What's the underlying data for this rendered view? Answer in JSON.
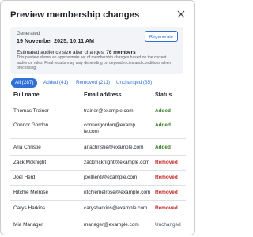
{
  "dialog": {
    "title": "Preview membership changes"
  },
  "summary": {
    "generated_label": "Generated",
    "generated_date": "19 November 2025, 10:11 AM",
    "regenerate_label": "Regenerate",
    "estimate_prefix": "Estimated audience size after changes:",
    "estimate_value": "76 members",
    "note": "This preview shows an approximate set of membership changes based on the current audience rules. Final results may vary depending on dependencies and conditions when processing."
  },
  "tabs": [
    {
      "label": "All (287)",
      "active": true
    },
    {
      "label": "Added (41)",
      "active": false
    },
    {
      "label": "Removed (211)",
      "active": false
    },
    {
      "label": "Unchanged (35)",
      "active": false
    }
  ],
  "table": {
    "columns": [
      "Full name",
      "Email address",
      "Status"
    ],
    "rows": [
      {
        "name": "Thomas Trainer",
        "email": "trainer@example.com",
        "status": "Added"
      },
      {
        "name": "Connor Gordon",
        "email": "connorgordon@example.com",
        "status": "Added"
      },
      {
        "name": "Aria Christie",
        "email": "ariachristie@example.com",
        "status": "Added"
      },
      {
        "name": "Zack Mcknight",
        "email": "zackmcknight@example.com",
        "status": "Removed"
      },
      {
        "name": "Joel Herd",
        "email": "joelherd@example.com",
        "status": "Removed"
      },
      {
        "name": "Ritchie Melrose",
        "email": "ritchiemelrose@example.com",
        "status": "Removed"
      },
      {
        "name": "Carys Harkins",
        "email": "carysharkins@example.com",
        "status": "Removed"
      },
      {
        "name": "Mia Manager",
        "email": "manager@example.com",
        "status": "Unchanged"
      }
    ]
  },
  "colors": {
    "accent": "#2f6fd6",
    "added": "#2e7d1f",
    "removed": "#c62828",
    "unchanged": "#4b5563"
  },
  "icons": {
    "close": "close-icon"
  }
}
